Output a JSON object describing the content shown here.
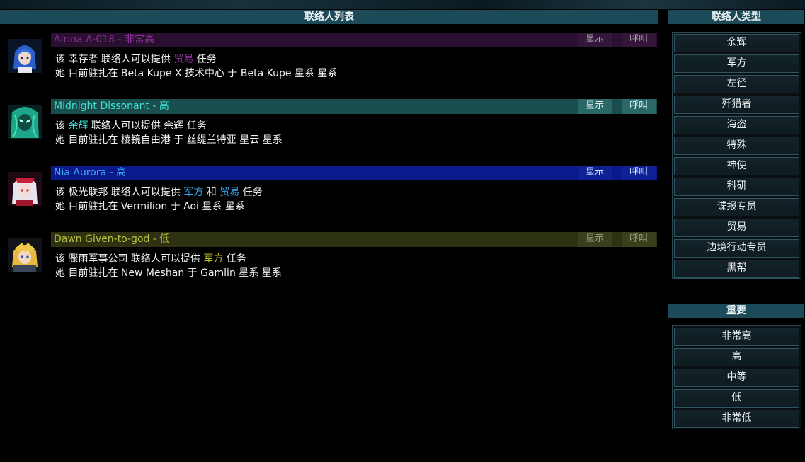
{
  "list_header": "联络人列表",
  "type_header": "联络人类型",
  "importance_header": "重要",
  "contacts": [
    {
      "name": "Alrina A-018 - 非常高",
      "show_label": "显示",
      "call_label": "呼叫",
      "line1": {
        "prefix": "该 幸存者 联络人可以提供 ",
        "k1": "贸易",
        "mid": "",
        "k2": "",
        "suffix": " 任务"
      },
      "line2": "她 目前驻扎在 Beta Kupe X 技术中心 于 Beta Kupe 星系 星系",
      "colors": {
        "bar": "#2a0f30",
        "name": "#8a2f95",
        "btn": "#33163a",
        "btn_text": "#a8a8a8",
        "keyword": "#8a2f95"
      }
    },
    {
      "name": "Midnight Dissonant - 高",
      "show_label": "显示",
      "call_label": "呼叫",
      "line1": {
        "prefix": "该 ",
        "k1": "余辉",
        "mid": " 联络人可以提供 余辉",
        "k2": "",
        "suffix": " 任务"
      },
      "line2": "她 目前驻扎在 棱镜自由港 于 丝缇兰特亚 星云 星系",
      "colors": {
        "bar": "#1a4e4e",
        "name": "#3fe0d0",
        "btn": "#2a6868",
        "btn_text": "#d8f0f0",
        "keyword": "#3fe0d0"
      }
    },
    {
      "name": "Nia Aurora - 高",
      "show_label": "显示",
      "call_label": "呼叫",
      "line1": {
        "prefix": "该 极光联邦 联络人可以提供 ",
        "k1": "军方",
        "mid": " 和 ",
        "k2": "贸易",
        "suffix": " 任务"
      },
      "line2": "她 目前驻扎在 Vermilion 于 Aoi 星系 星系",
      "colors": {
        "bar": "#0a1a8c",
        "name": "#3ab0f0",
        "btn": "#0e2296",
        "btn_text": "#e0e8ff",
        "keyword": "#3a9ee8"
      }
    },
    {
      "name": "Dawn Given-to-god - 低",
      "show_label": "显示",
      "call_label": "呼叫",
      "line1": {
        "prefix": "该 骤雨军事公司 联络人可以提供 ",
        "k1": "军方",
        "mid": "",
        "k2": "",
        "suffix": " 任务"
      },
      "line2": "她 目前驻扎在 New Meshan 于 Gamlin 星系 星系",
      "colors": {
        "bar": "#2e3212",
        "name": "#b8c040",
        "btn": "#3a3e1a",
        "btn_text": "#9a9a8a",
        "keyword": "#c0c030"
      }
    }
  ],
  "contact_types": [
    "余辉",
    "军方",
    "左径",
    "歼猎者",
    "海盗",
    "特殊",
    "神使",
    "科研",
    "谍报专员",
    "贸易",
    "边境行动专员",
    "黑帮"
  ],
  "importance_levels": [
    "非常高",
    "高",
    "中等",
    "低",
    "非常低"
  ]
}
